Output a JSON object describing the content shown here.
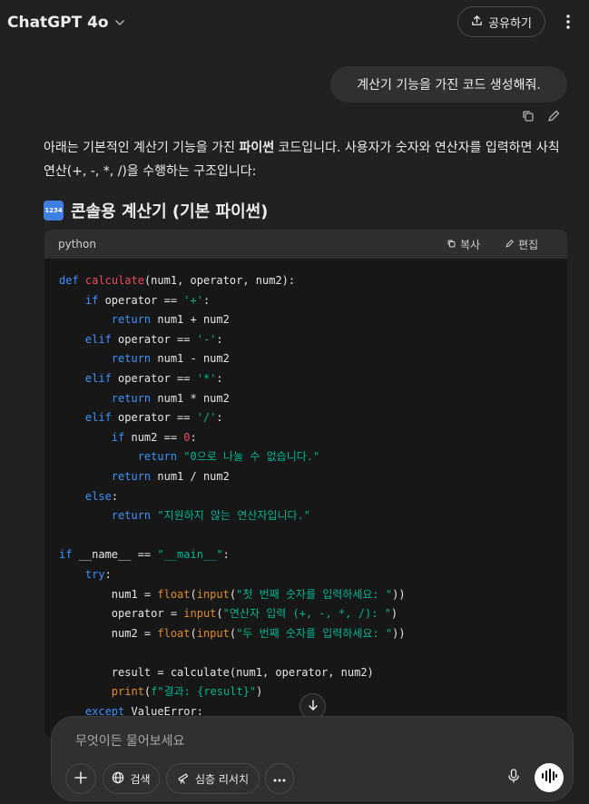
{
  "header": {
    "model_name": "ChatGPT 4o",
    "share_label": "공유하기"
  },
  "user_message": {
    "text": "계산기 기능을 가진 코드 생성해줘."
  },
  "assistant": {
    "para_part1": "아래는 기본적인 계산기 기능을 가진 ",
    "para_bold": "파이썬",
    "para_part2": " 코드입니다. 사용자가 숫자와 연산자를 입력하면 사칙연산(+, -, *, /)을 수행하는 구조입니다:",
    "heading_icon_text": "1234",
    "heading": "콘솔용 계산기 (기본 파이썬)"
  },
  "code_block": {
    "language": "python",
    "copy_label": "복사",
    "edit_label": "편집"
  },
  "composer": {
    "placeholder": "무엇이든 물어보세요",
    "search_label": "검색",
    "research_label": "심층 리서치"
  },
  "colors": {
    "background": "#212121",
    "keyword": "#3c93ff",
    "function_name": "#ee4b5c",
    "string": "#00b38f",
    "builtin": "#e08a2e"
  }
}
